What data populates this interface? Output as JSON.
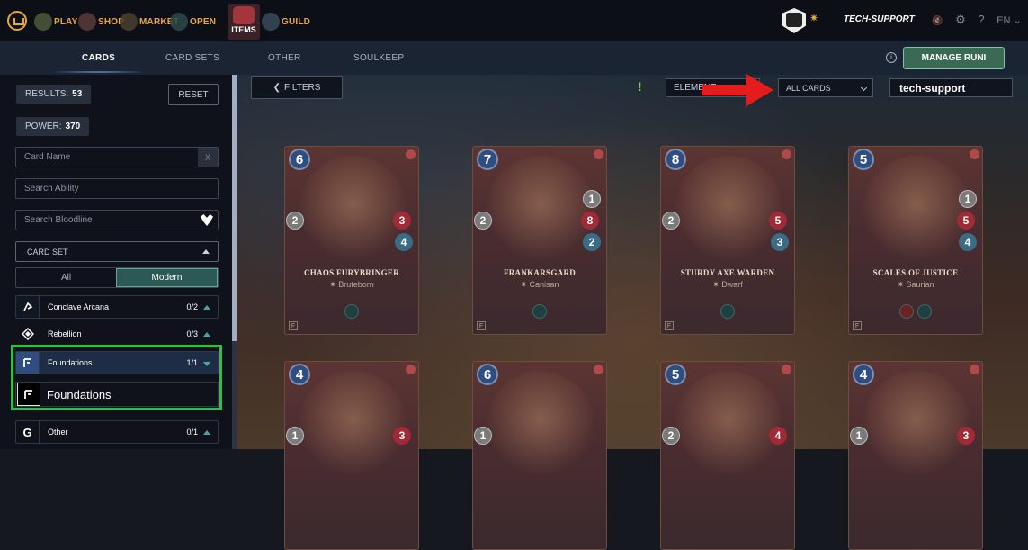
{
  "topnav": {
    "items": [
      {
        "label": "PLAY",
        "icon": "play-icon"
      },
      {
        "label": "SHOP",
        "icon": "shop-icon"
      },
      {
        "label": "MARKET",
        "icon": "market-icon"
      },
      {
        "label": "OPEN",
        "icon": "open-icon"
      },
      {
        "label": "ITEMS",
        "icon": "items-icon"
      },
      {
        "label": "GUILD",
        "icon": "guild-icon"
      }
    ],
    "username": "TECH-SUPPORT",
    "language": "EN",
    "lang_caret": "⌄",
    "mute_icon": "🔇",
    "gear_icon": "⚙",
    "help_icon": "?"
  },
  "subnav": {
    "tabs": [
      "CARDS",
      "CARD SETS",
      "Other",
      "SOULKEEP"
    ],
    "info_icon": "i",
    "manage_label": "MANAGE RUNI"
  },
  "sidebar": {
    "results_label": "RESULTS:",
    "results_value": "53",
    "reset_label": "RESET",
    "power_label": "POWER:",
    "power_value": "370",
    "card_name_placeholder": "Card Name",
    "clear_label": "X",
    "ability_placeholder": "Search Ability",
    "bloodline_placeholder": "Search Bloodline",
    "card_set_label": "CARD SET",
    "toggle": [
      "All",
      "Modern"
    ],
    "sets": [
      {
        "name": "Conclave Arcana",
        "count": "0/2"
      },
      {
        "name": "Rebellion",
        "count": "0/3"
      },
      {
        "name": "Foundations",
        "count": "1/1"
      },
      {
        "name": "Other",
        "count": "0/1"
      }
    ],
    "foundations_sub": "Foundations",
    "foundations_glyph": "F",
    "other_glyph": "G"
  },
  "toolbar": {
    "filters_label": "FILTERS",
    "filters_arrow": "❮",
    "element_label": "ELEMENT",
    "cards_select": "ALL CARDS",
    "search_value": "tech-support",
    "mana_glyph": "!"
  },
  "cards": [
    {
      "name": "CHAOS FURYBRINGER",
      "race": "Bruteborn",
      "mana": "6",
      "attack": "",
      "melee": "2",
      "health": "3",
      "speed": "4"
    },
    {
      "name": "FRANKARSGARD",
      "race": "Canisan",
      "mana": "7",
      "attack": "1",
      "melee": "2",
      "health": "8",
      "speed": "2"
    },
    {
      "name": "STURDY AXE WARDEN",
      "race": "Dwarf",
      "mana": "8",
      "attack": "",
      "melee": "2",
      "health": "5",
      "speed": "3"
    },
    {
      "name": "SCALES OF JUSTICE",
      "race": "Saurian",
      "mana": "5",
      "attack": "1",
      "melee": "",
      "health": "5",
      "speed": "4"
    },
    {
      "name": "",
      "race": "",
      "mana": "4",
      "attack": "",
      "melee": "1",
      "health": "3",
      "speed": ""
    },
    {
      "name": "",
      "race": "",
      "mana": "6",
      "attack": "",
      "melee": "1",
      "health": "",
      "speed": ""
    },
    {
      "name": "",
      "race": "",
      "mana": "5",
      "attack": "",
      "melee": "2",
      "health": "4",
      "speed": ""
    },
    {
      "name": "",
      "race": "",
      "mana": "4",
      "attack": "",
      "melee": "1",
      "health": "3",
      "speed": ""
    }
  ],
  "card_glyphs": {
    "race_mark": "✷",
    "edition": "F"
  },
  "colors": {
    "accent_gold": "#e4a748",
    "highlight_green": "#25c34a",
    "manage_bg": "#3b6a54"
  }
}
